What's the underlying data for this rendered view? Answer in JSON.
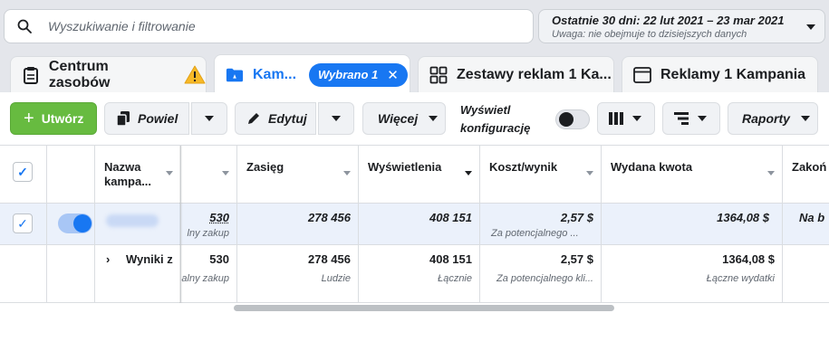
{
  "search": {
    "placeholder": "Wyszukiwanie i filtrowanie"
  },
  "date_range": {
    "line1": "Ostatnie 30 dni: 22 lut 2021 – 23 mar 2021",
    "line2": "Uwaga: nie obejmuje to dzisiejszych danych"
  },
  "tabs": [
    {
      "label": "Centrum zasobów",
      "icon": "clipboard-icon"
    },
    {
      "label": "Kam...",
      "icon": "folder-icon",
      "badge": "Wybrano 1"
    },
    {
      "label": "Zestawy reklam 1 Ka...",
      "icon": "grid-icon"
    },
    {
      "label": "Reklamy 1 Kampania",
      "icon": "ad-window-icon"
    }
  ],
  "toolbar": {
    "create": "Utwórz",
    "duplicate": "Powiel",
    "edit": "Edytuj",
    "more": "Więcej",
    "show_config": "Wyświetl konfigurację",
    "reports": "Raporty"
  },
  "table": {
    "headers": {
      "name": "Nazwa kampa...",
      "reach": "Zasięg",
      "impressions": "Wyświetlenia",
      "cost_per_result": "Koszt/wynik",
      "amount_spent": "Wydana kwota",
      "ends": "Zakoń"
    },
    "row": {
      "results": "530",
      "results_sub": "lny zakup",
      "reach": "278 456",
      "impressions": "408 151",
      "cost_per_result": "2,57 $",
      "cost_sub": "Za potencjalnego ...",
      "amount_spent": "1364,08 $",
      "ends": "Na b"
    },
    "totals": {
      "label": "Wyniki z",
      "results": "530",
      "results_sub": "alny zakup",
      "reach": "278 456",
      "reach_sub": "Ludzie",
      "impressions": "408 151",
      "impressions_sub": "Łącznie",
      "cost_per_result": "2,57 $",
      "cost_sub": "Za potencjalnego kli...",
      "amount_spent": "1364,08 $",
      "amount_sub": "Łączne wydatki"
    }
  },
  "colors": {
    "accent": "#1877f2",
    "create_green": "#67bb40",
    "warning": "#f7b928"
  }
}
